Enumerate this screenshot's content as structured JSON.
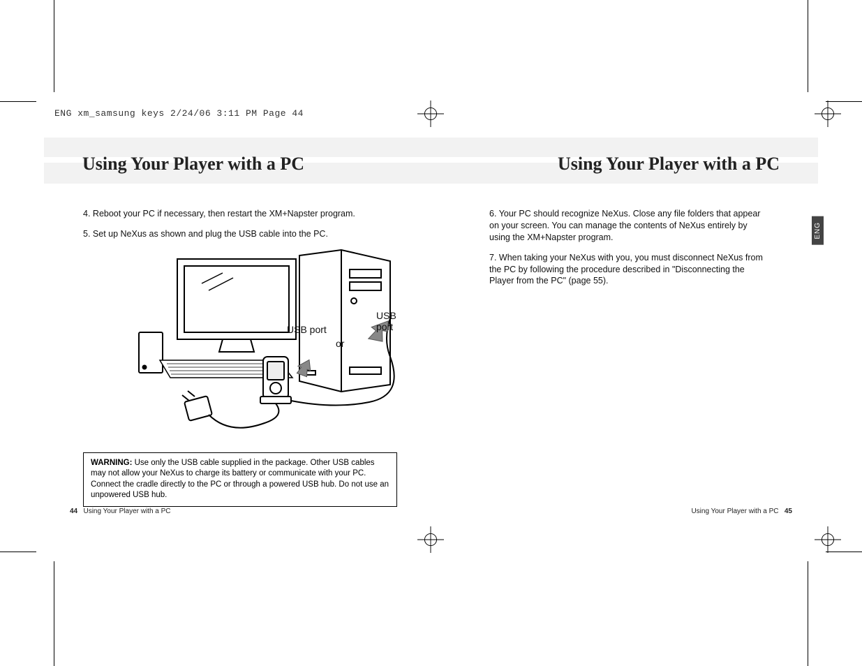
{
  "slug": "ENG xm_samsung keys  2/24/06  3:11 PM  Page 44",
  "title_left": "Using Your Player with a PC",
  "title_right": "Using Your Player with a PC",
  "left_page": {
    "steps": [
      {
        "num": "4.",
        "text": "Reboot your PC if necessary, then restart the XM+Napster program."
      },
      {
        "num": "5.",
        "text": "Set up NeXus as shown and plug the USB cable into the PC."
      }
    ],
    "illustration": {
      "label_usb_port_1": "USB port",
      "label_or": "or",
      "label_usb_port_2": "USB port"
    },
    "warning_label": "WARNING:",
    "warning_text": "Use only the USB cable supplied in the package. Other USB cables may not allow your NeXus to charge its battery or communicate with your PC. Connect the cradle directly to the PC or through a powered USB hub. Do not use an unpowered USB hub.",
    "footer_num": "44",
    "footer_text": "Using Your Player with a PC"
  },
  "right_page": {
    "steps": [
      {
        "num": "6.",
        "text": "Your PC should recognize NeXus. Close any file folders that appear on your screen. You can manage the contents of NeXus entirely by using the XM+Napster program."
      },
      {
        "num": "7.",
        "text": "When taking your NeXus with you, you must disconnect NeXus from the PC by following the procedure described in \"Disconnecting the Player from the PC\" (page 55)."
      }
    ],
    "lang_tab": "ENG",
    "footer_text": "Using Your Player with a PC",
    "footer_num": "45"
  }
}
